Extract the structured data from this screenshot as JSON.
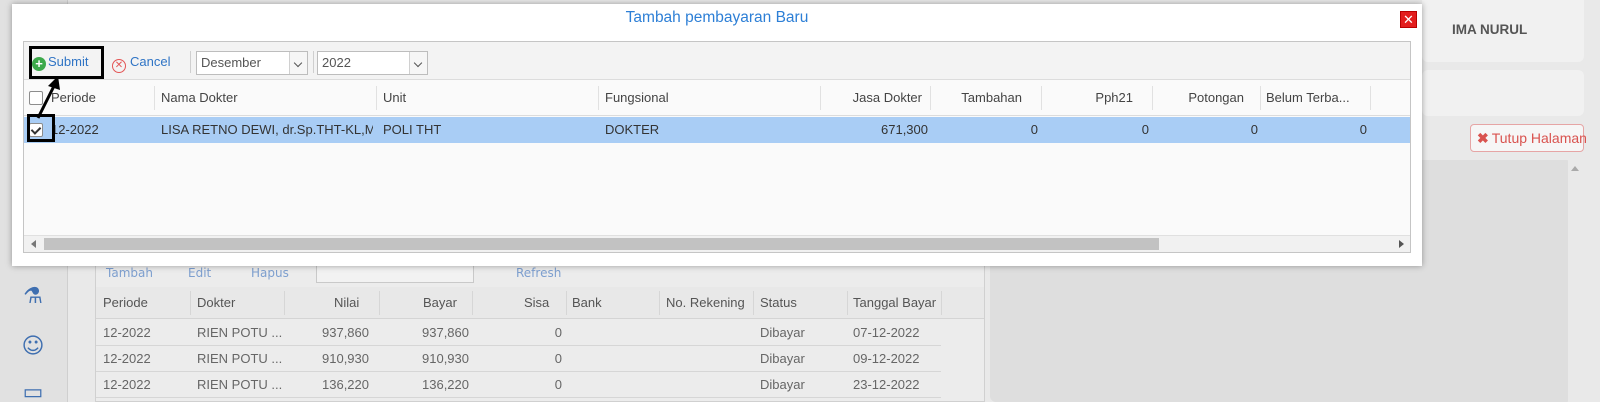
{
  "background": {
    "user_name": "IMA NURUL",
    "close_page_label": "Tutup Halaman",
    "toolbar": {
      "add": "Tambah",
      "edit": "Edit",
      "delete": "Hapus",
      "refresh": "Refresh"
    },
    "columns": [
      "Periode",
      "Dokter",
      "Nilai",
      "Bayar",
      "Sisa",
      "Bank",
      "No. Rekening",
      "Status",
      "Tanggal Bayar"
    ],
    "rows": [
      {
        "periode": "12-2022",
        "dokter": "RIEN POTU ...",
        "nilai": "937,860",
        "bayar": "937,860",
        "sisa": "0",
        "bank": "",
        "rekening": "",
        "status": "Dibayar",
        "tanggal": "07-12-2022"
      },
      {
        "periode": "12-2022",
        "dokter": "RIEN POTU ...",
        "nilai": "910,930",
        "bayar": "910,930",
        "sisa": "0",
        "bank": "",
        "rekening": "",
        "status": "Dibayar",
        "tanggal": "09-12-2022"
      },
      {
        "periode": "12-2022",
        "dokter": "RIEN POTU ...",
        "nilai": "136,220",
        "bayar": "136,220",
        "sisa": "0",
        "bank": "",
        "rekening": "",
        "status": "Dibayar",
        "tanggal": "23-12-2022"
      }
    ],
    "sidebar_icons": [
      "mortar-pestle-icon",
      "doctor-icon",
      "card-icon"
    ]
  },
  "modal": {
    "title": "Tambah pembayaran Baru",
    "close_icon": "close-icon",
    "toolbar": {
      "submit_label": "Submit",
      "cancel_label": "Cancel",
      "month_value": "Desember",
      "year_value": "2022"
    },
    "columns": [
      "Periode",
      "Nama Dokter",
      "Unit",
      "Fungsional",
      "Jasa Dokter",
      "Tambahan",
      "Pph21",
      "Potongan",
      "Belum Terba..."
    ],
    "rows": [
      {
        "checked": true,
        "periode": "12-2022",
        "nama_dokter": "LISA RETNO DEWI, dr.Sp.THT-KL,M....",
        "unit": "POLI THT",
        "fungsional": "DOKTER",
        "jasa_dokter": "671,300",
        "tambahan": "0",
        "pph21": "0",
        "potongan": "0",
        "belum_terbayar": "0"
      }
    ]
  },
  "colors": {
    "title_blue": "#2d7fd6",
    "selected_row": "#a9cdf5",
    "close_red": "#e31d1d",
    "submit_green": "#3ca94a"
  }
}
